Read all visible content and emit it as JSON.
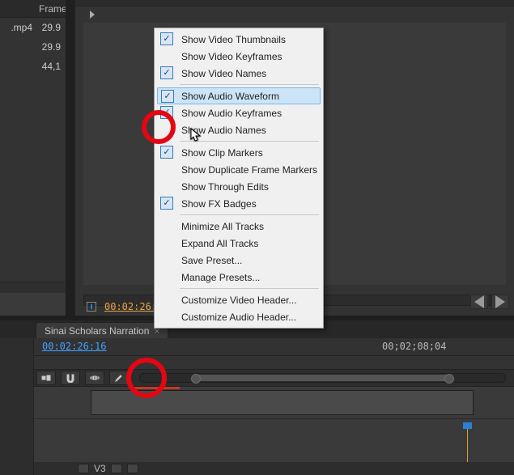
{
  "project": {
    "col_header": "Frame",
    "rows": [
      {
        "name": ".mp4",
        "rate": "29.9"
      },
      {
        "name": "",
        "rate": "29.9"
      },
      {
        "name": "",
        "rate": "44,1"
      }
    ]
  },
  "effects": {
    "timecode": "00:02:26:16",
    "nav_prev_icon": "step-back",
    "nav_play_icon": "play",
    "nav_next_icon": "step-fwd"
  },
  "timeline": {
    "tab_label": "Sinai Scholars Narration",
    "timecode": "00:02:26:16",
    "ruler_mark": "00;02;08;04",
    "track_footer_label": "V3",
    "tool_icons": [
      "insert",
      "snap",
      "linked",
      "wrench"
    ]
  },
  "menu": {
    "items": [
      {
        "label": "Show Video Thumbnails",
        "checked": true,
        "highlight": false
      },
      {
        "label": "Show Video Keyframes",
        "checked": false,
        "highlight": false
      },
      {
        "label": "Show Video Names",
        "checked": true,
        "highlight": false
      },
      {
        "sep": true
      },
      {
        "label": "Show Audio Waveform",
        "checked": true,
        "highlight": true
      },
      {
        "label": "Show Audio Keyframes",
        "checked": true,
        "highlight": false
      },
      {
        "label": "Show Audio Names",
        "checked": false,
        "highlight": false
      },
      {
        "sep": true
      },
      {
        "label": "Show Clip Markers",
        "checked": true,
        "highlight": false
      },
      {
        "label": "Show Duplicate Frame Markers",
        "checked": false,
        "highlight": false
      },
      {
        "label": "Show Through Edits",
        "checked": false,
        "highlight": false
      },
      {
        "label": "Show FX Badges",
        "checked": true,
        "highlight": false
      },
      {
        "sep": true
      },
      {
        "label": "Minimize All Tracks",
        "checked": false,
        "highlight": false
      },
      {
        "label": "Expand All Tracks",
        "checked": false,
        "highlight": false
      },
      {
        "label": "Save Preset...",
        "checked": false,
        "highlight": false
      },
      {
        "label": "Manage Presets...",
        "checked": false,
        "highlight": false
      },
      {
        "sep": true
      },
      {
        "label": "Customize Video Header...",
        "checked": false,
        "highlight": false
      },
      {
        "label": "Customize Audio Header...",
        "checked": false,
        "highlight": false
      }
    ]
  }
}
